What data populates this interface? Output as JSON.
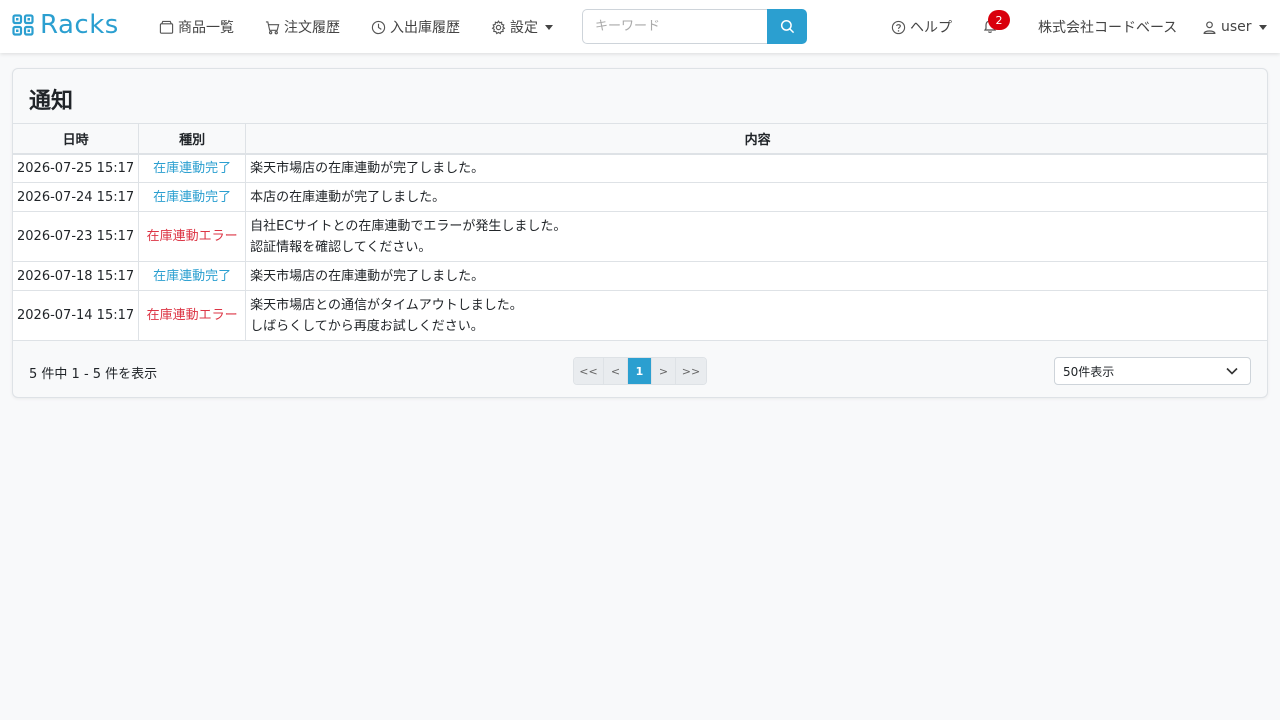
{
  "brand": {
    "name": "Racks"
  },
  "nav": {
    "products": "商品一覧",
    "orders": "注文履歴",
    "stock": "入出庫履歴",
    "settings": "設定"
  },
  "search": {
    "placeholder": "キーワード"
  },
  "right": {
    "help": "ヘルプ",
    "notification_count": "2",
    "company": "株式会社コードベース",
    "user": "user"
  },
  "page": {
    "title": "通知"
  },
  "table": {
    "headers": [
      "日時",
      "種別",
      "内容"
    ],
    "rows": [
      {
        "date": "2026-07-25 15:17",
        "kind": "在庫連動完了",
        "status": "ok",
        "lines": [
          "楽天市場店の在庫連動が完了しました。"
        ]
      },
      {
        "date": "2026-07-24 15:17",
        "kind": "在庫連動完了",
        "status": "ok",
        "lines": [
          "本店の在庫連動が完了しました。"
        ]
      },
      {
        "date": "2026-07-23 15:17",
        "kind": "在庫連動エラー",
        "status": "error",
        "lines": [
          "自社ECサイトとの在庫連動でエラーが発生しました。",
          "認証情報を確認してください。"
        ]
      },
      {
        "date": "2026-07-18 15:17",
        "kind": "在庫連動完了",
        "status": "ok",
        "lines": [
          "楽天市場店の在庫連動が完了しました。"
        ]
      },
      {
        "date": "2026-07-14 15:17",
        "kind": "在庫連動エラー",
        "status": "error",
        "lines": [
          "楽天市場店との通信がタイムアウトしました。",
          "しばらくしてから再度お試しください。"
        ]
      }
    ]
  },
  "footer": {
    "count_text": "5 件中 1 - 5 件を表示",
    "pager": [
      "<<",
      "<",
      "1",
      ">",
      ">>"
    ],
    "pager_active": "1",
    "per_page": "50件表示"
  },
  "colors": {
    "accent": "#2b9fd0",
    "ok": "#2b9fd0",
    "error": "#dc3545",
    "badge": "#d9000c"
  }
}
